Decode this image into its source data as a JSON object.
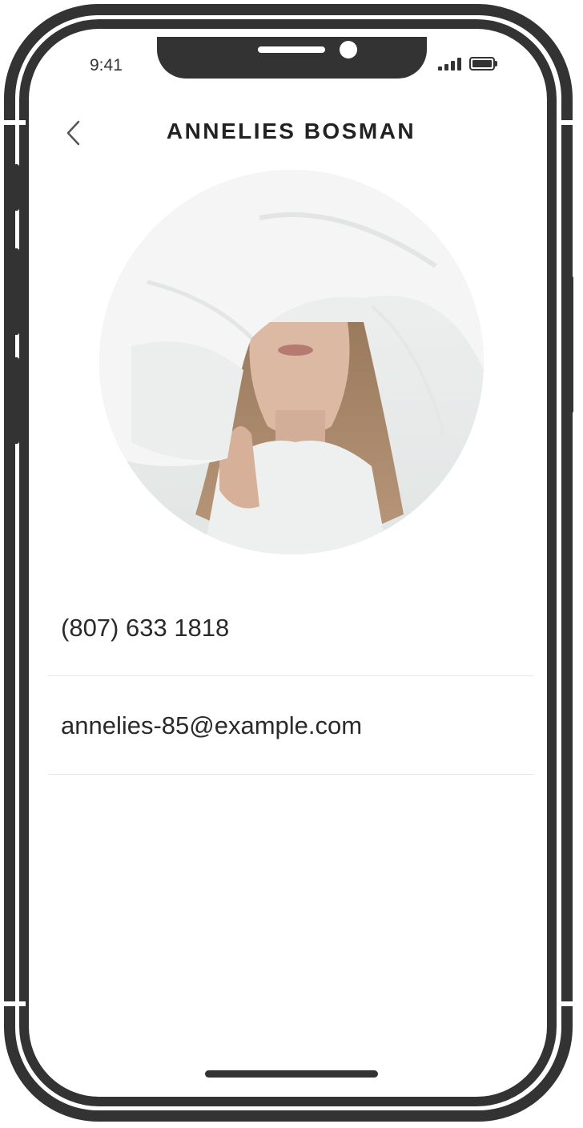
{
  "status_bar": {
    "time": "9:41"
  },
  "nav": {
    "back_icon": "chevron-left-icon",
    "title": "ANNELIES BOSMAN"
  },
  "profile": {
    "photo_description_icon": "profile-photo"
  },
  "contact": {
    "phone": "(807) 633 1818",
    "email": "annelies-85@example.com"
  },
  "colors": {
    "frame": "#333333",
    "text": "#222222",
    "divider": "#e8e8e8"
  }
}
